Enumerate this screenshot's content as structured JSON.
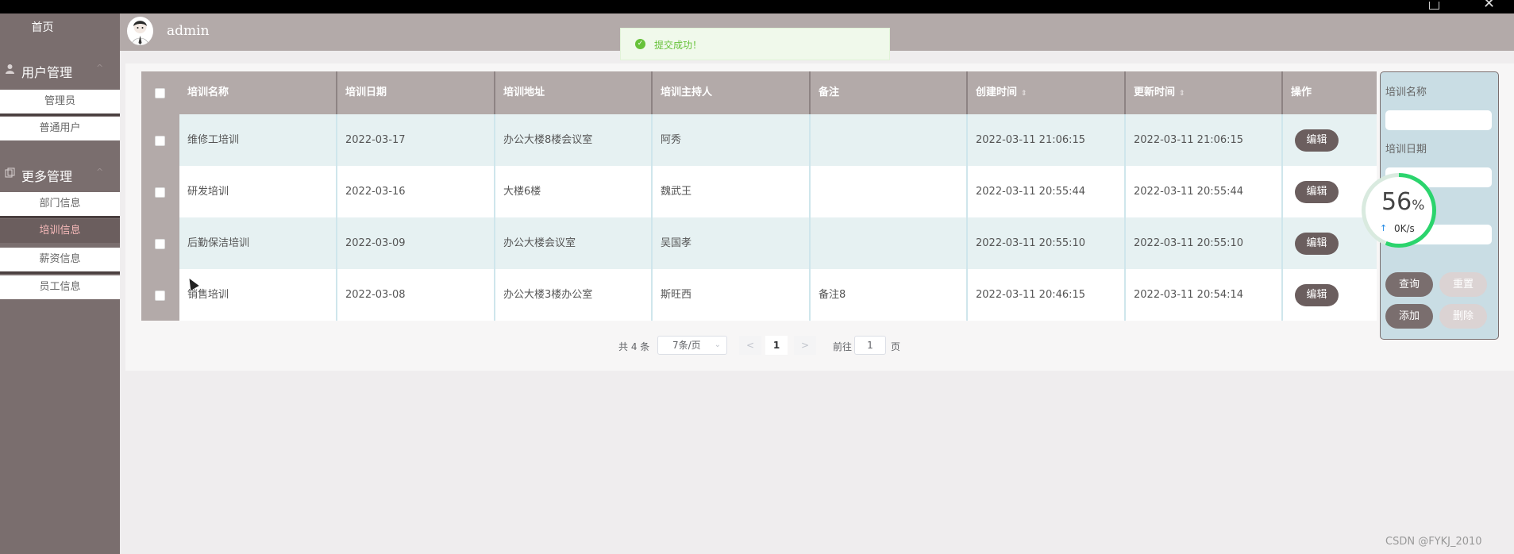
{
  "sidebar": {
    "home": "首页",
    "groups": [
      {
        "label": "用户管理",
        "icon": "user-icon",
        "arrow": "^",
        "items": [
          "管理员",
          "普通用户"
        ]
      },
      {
        "label": "更多管理",
        "icon": "copy-icon",
        "arrow": "^",
        "items": [
          "部门信息",
          "培训信息",
          "薪资信息",
          "员工信息"
        ]
      }
    ],
    "active_item": "培训信息"
  },
  "header": {
    "username": "admin"
  },
  "toast": {
    "message": "提交成功！",
    "type": "success"
  },
  "table": {
    "headers": [
      "培训名称",
      "培训日期",
      "培训地址",
      "培训主持人",
      "备注",
      "创建时间",
      "更新时间",
      "操作"
    ],
    "sortable_columns": [
      "创建时间",
      "更新时间"
    ],
    "sort_glyph": "⇕",
    "edit_label": "编辑",
    "rows": [
      {
        "name": "维修工培训",
        "date": "2022-03-17",
        "address": "办公大楼8楼会议室",
        "host": "阿秀",
        "remark": "",
        "created": "2022-03-11 21:06:15",
        "updated": "2022-03-11 21:06:15"
      },
      {
        "name": "研发培训",
        "date": "2022-03-16",
        "address": "大楼6楼",
        "host": "魏武王",
        "remark": "",
        "created": "2022-03-11 20:55:44",
        "updated": "2022-03-11 20:55:44"
      },
      {
        "name": "后勤保洁培训",
        "date": "2022-03-09",
        "address": "办公大楼会议室",
        "host": "吴国孝",
        "remark": "",
        "created": "2022-03-11 20:55:10",
        "updated": "2022-03-11 20:55:10"
      },
      {
        "name": "销售培训",
        "date": "2022-03-08",
        "address": "办公大楼3楼办公室",
        "host": "斯旺西",
        "remark": "备注8",
        "created": "2022-03-11 20:46:15",
        "updated": "2022-03-11 20:54:14"
      }
    ]
  },
  "pagination": {
    "total": "共 4 条",
    "page_size": "7条/页",
    "prev": "<",
    "current": "1",
    "next": ">",
    "goto_label": "前往",
    "goto_value": "1",
    "page_suffix": "页"
  },
  "search": {
    "fields": [
      "培训名称",
      "培训日期"
    ],
    "buttons": {
      "query": "查询",
      "reset": "重置",
      "add": "添加",
      "delete": "删除"
    }
  },
  "speed_widget": {
    "percent": "56",
    "unit": "%",
    "rate": "0K/s",
    "percent_value": 56
  },
  "watermark": "CSDN @FYKJ_2010",
  "colors": {
    "sidebar": "#7a6e6e",
    "header": "#b3aaa9",
    "row_alt": "#e6f1f2",
    "button": "#6b5e5e",
    "search_panel": "#c9dde4",
    "success": "#67c23a"
  }
}
